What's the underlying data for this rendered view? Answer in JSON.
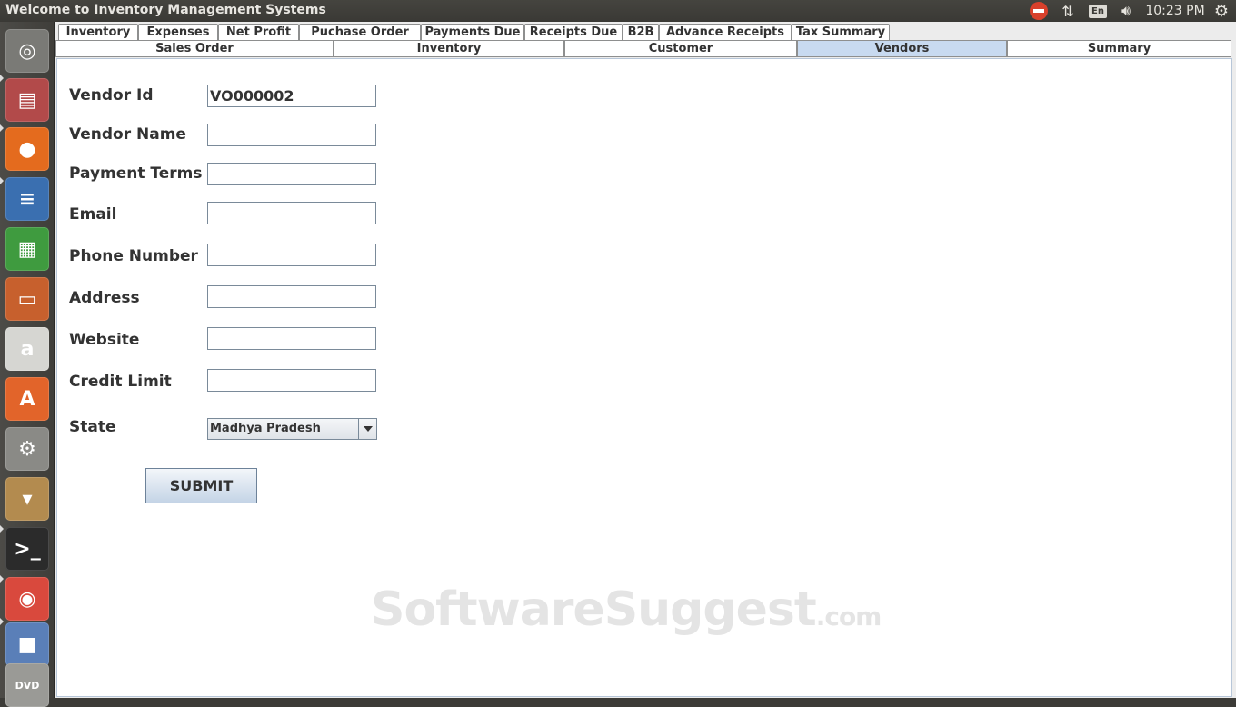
{
  "window": {
    "title": "Welcome to Inventory Management Systems"
  },
  "tray": {
    "language": "En",
    "time": "10:23 PM"
  },
  "launcher": {
    "items": [
      {
        "name": "ubuntu-dash-icon",
        "color": "#7a7a76",
        "glyph": "◎"
      },
      {
        "name": "file-cabinet-icon",
        "color": "#b24a4a",
        "glyph": "▤"
      },
      {
        "name": "firefox-icon",
        "color": "#e46b1e",
        "glyph": "●"
      },
      {
        "name": "writer-icon",
        "color": "#3a6fb0",
        "glyph": "≡"
      },
      {
        "name": "calc-icon",
        "color": "#3f9b3f",
        "glyph": "▦"
      },
      {
        "name": "impress-icon",
        "color": "#c7602d",
        "glyph": "▭"
      },
      {
        "name": "amazon-icon",
        "color": "#d6d6d2",
        "glyph": "a"
      },
      {
        "name": "software-center-icon",
        "color": "#e2642a",
        "glyph": "A"
      },
      {
        "name": "system-settings-icon",
        "color": "#8a8a86",
        "glyph": "⚙"
      },
      {
        "name": "archive-icon",
        "color": "#b38b4f",
        "glyph": "▾"
      },
      {
        "name": "terminal-icon",
        "color": "#2b2b2b",
        "glyph": ">_"
      },
      {
        "name": "chrome-icon",
        "color": "#d9493d",
        "glyph": "◉"
      },
      {
        "name": "virtualbox-icon",
        "color": "#5a7fb8",
        "glyph": "■"
      },
      {
        "name": "dvd-icon",
        "color": "#9a9a96",
        "glyph": "DVD"
      }
    ]
  },
  "tabs_top": [
    "Inventory",
    "Expenses",
    "Net Profit",
    "Puchase Order",
    "Payments Due",
    "Receipts Due",
    "B2B",
    "Advance Receipts",
    "Tax Summary"
  ],
  "tabs_sub": [
    "Sales Order",
    "Inventory",
    "Customer",
    "Vendors",
    "Summary"
  ],
  "form": {
    "vendor_id_label": "Vendor Id",
    "vendor_id_value": "VO000002",
    "vendor_name_label": "Vendor Name",
    "vendor_name_value": "",
    "payment_terms_label": "Payment Terms",
    "payment_terms_value": "",
    "email_label": "Email",
    "email_value": "",
    "phone_label": "Phone Number",
    "phone_value": "",
    "address_label": "Address",
    "address_value": "",
    "website_label": "Website",
    "website_value": "",
    "credit_limit_label": "Credit Limit",
    "credit_limit_value": "",
    "state_label": "State",
    "state_value": "Madhya Pradesh",
    "submit_label": "SUBMIT"
  },
  "watermark": {
    "main": "SoftwareSuggest",
    "suffix": ".com"
  }
}
